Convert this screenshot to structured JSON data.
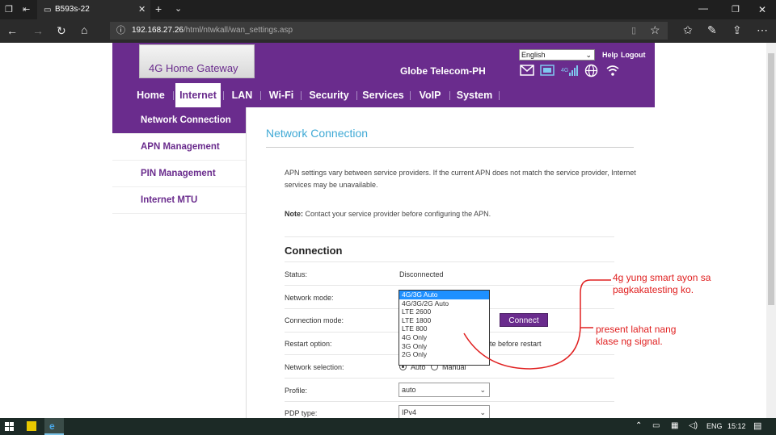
{
  "browser": {
    "tab_title": "B593s-22",
    "url_host": "192.168.27.26",
    "url_path": "/html/ntwkall/wan_settings.asp"
  },
  "header": {
    "product_name": "4G Home Gateway",
    "provider": "Globe Telecom-PH",
    "language": "English",
    "help_label": "Help",
    "logout_label": "Logout"
  },
  "nav": {
    "items": [
      "Home",
      "Internet",
      "LAN",
      "Wi-Fi",
      "Security",
      "Services",
      "VoIP",
      "System"
    ],
    "active": "Internet"
  },
  "sidebar": {
    "items": [
      "Network Connection",
      "APN Management",
      "PIN Management",
      "Internet MTU"
    ]
  },
  "main": {
    "page_title": "Network Connection",
    "info_text_1": "APN settings vary between service providers. If the current APN does not match the service provider, Internet",
    "info_text_2": "services may be unavailable.",
    "note_label": "Note:",
    "note_text": " Contact your service provider before configuring the APN.",
    "section_title": "Connection",
    "status_label": "Status:",
    "status_value": "Disconnected",
    "network_mode_label": "Network mode:",
    "network_mode_options": [
      "4G/3G Auto",
      "4G/3G/2G Auto",
      "LTE 2600",
      "LTE 1800",
      "LTE 800",
      "4G Only",
      "3G Only",
      "2G Only"
    ],
    "network_mode_selected": "4G/3G Auto",
    "connection_mode_label": "Connection mode:",
    "connect_button": "Connect",
    "restart_label": "Restart option:",
    "restart_partial": "te before restart",
    "network_selection_label": "Network selection:",
    "network_selection_auto": "Auto",
    "network_selection_manual": "Manual",
    "profile_label": "Profile:",
    "profile_value": "auto",
    "pdp_label": "PDP type:",
    "pdp_value": "IPv4"
  },
  "annotations": {
    "note1_line1": "4g yung smart ayon sa",
    "note1_line2": "pagkakatesting ko.",
    "note2_line1": "present lahat nang",
    "note2_line2": "klase ng signal.",
    "color": "#e02020"
  },
  "taskbar": {
    "lang": "ENG",
    "time": "15:12"
  },
  "colors": {
    "brand_purple": "#6a2c8d",
    "title_blue": "#3fa9d5"
  }
}
